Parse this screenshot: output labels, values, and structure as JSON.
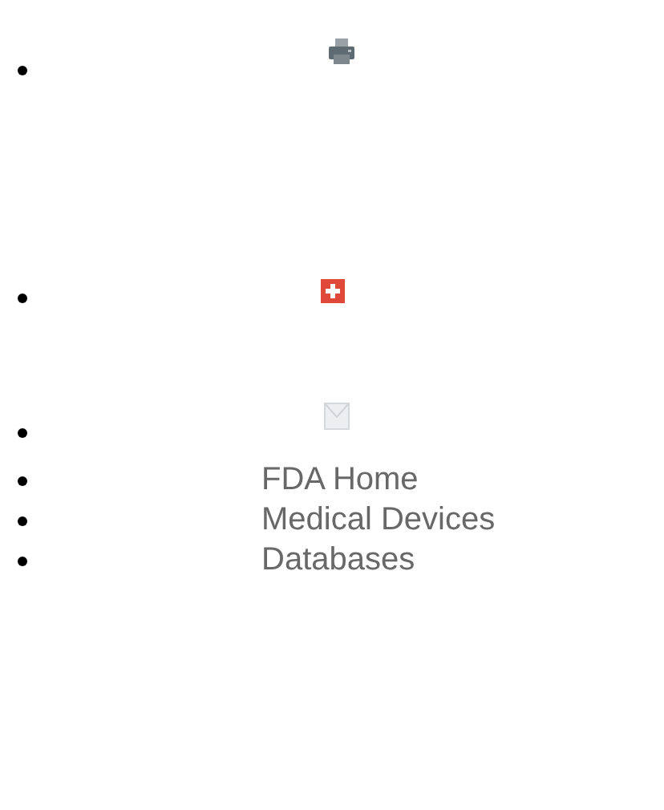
{
  "items": [
    {
      "kind": "print"
    },
    {
      "kind": "add"
    },
    {
      "kind": "email"
    },
    {
      "kind": "link",
      "label": "FDA Home"
    },
    {
      "kind": "link",
      "label": "Medical Devices"
    },
    {
      "kind": "link",
      "label": "Databases"
    }
  ]
}
